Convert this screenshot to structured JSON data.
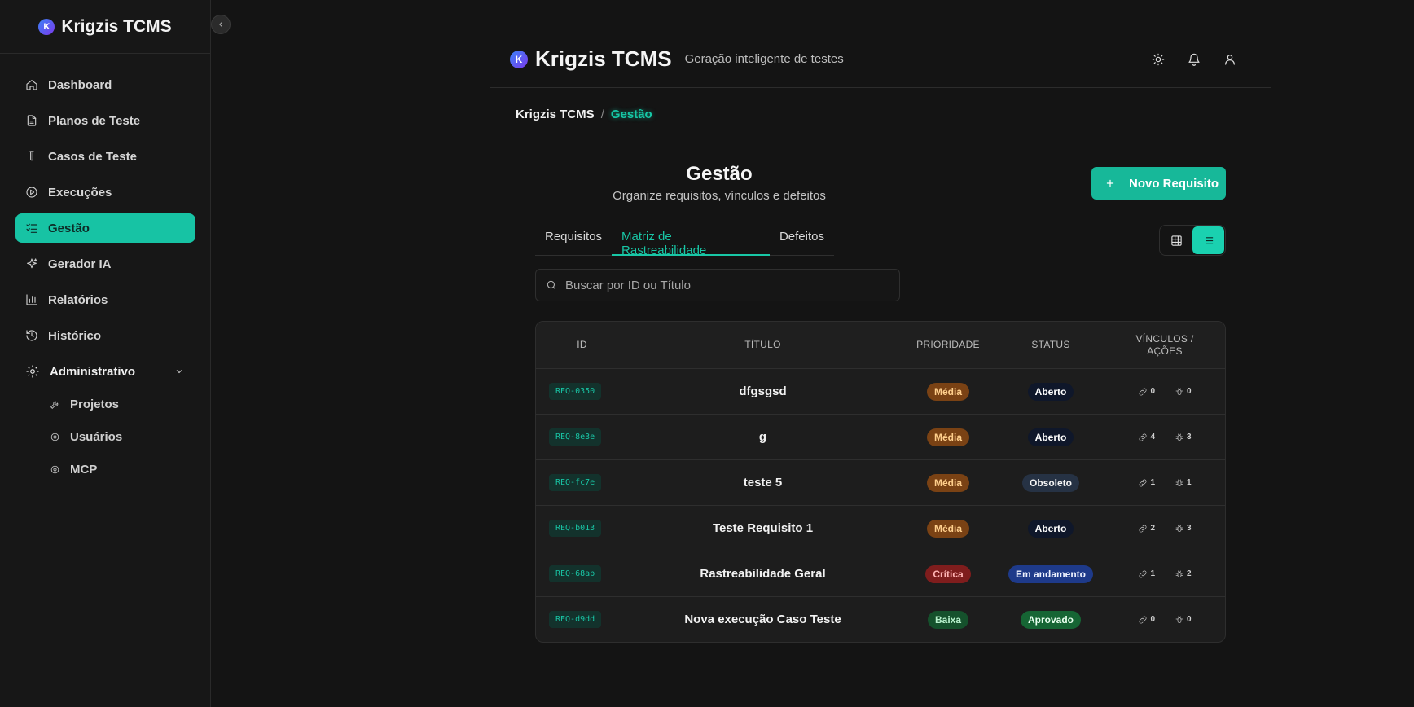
{
  "sidebar": {
    "brand": "Krigzis TCMS",
    "logo_letter": "K",
    "items": [
      {
        "label": "Dashboard",
        "icon": "home-icon"
      },
      {
        "label": "Planos de Teste",
        "icon": "document-icon"
      },
      {
        "label": "Casos de Teste",
        "icon": "test-tube-icon"
      },
      {
        "label": "Execuções",
        "icon": "play-icon"
      },
      {
        "label": "Gestão",
        "icon": "checklist-icon",
        "active": true
      },
      {
        "label": "Gerador IA",
        "icon": "sparkles-icon"
      },
      {
        "label": "Relatórios",
        "icon": "bar-chart-icon"
      },
      {
        "label": "Histórico",
        "icon": "history-icon"
      }
    ],
    "admin_group": {
      "label": "Administrativo",
      "children": [
        {
          "label": "Projetos",
          "icon": "wrench-icon"
        },
        {
          "label": "Usuários",
          "icon": "gear-icon"
        },
        {
          "label": "MCP",
          "icon": "gear-icon"
        }
      ]
    }
  },
  "header": {
    "title": "Krigzis TCMS",
    "tagline": "Geração inteligente de testes",
    "icons": [
      "sun-icon",
      "bell-icon",
      "user-icon"
    ]
  },
  "breadcrumb": {
    "root": "Krigzis TCMS",
    "separator": "/",
    "current": "Gestão"
  },
  "page": {
    "title": "Gestão",
    "subtitle": "Organize requisitos, vínculos e defeitos",
    "new_button": "Novo Requisito"
  },
  "tabs": [
    {
      "label": "Requisitos"
    },
    {
      "label": "Matriz de Rastreabilidade",
      "active": true
    },
    {
      "label": "Defeitos"
    }
  ],
  "view_toggle": {
    "options": [
      "grid-icon",
      "list-icon"
    ],
    "selected": "list-icon"
  },
  "search": {
    "placeholder": "Buscar por ID ou Título",
    "value": ""
  },
  "table": {
    "headers": {
      "id": "ID",
      "title": "TÍTULO",
      "priority": "PRIORIDADE",
      "status": "STATUS",
      "links_l1": "VÍNCULOS /",
      "links_l2": "AÇÕES"
    },
    "rows": [
      {
        "id": "REQ-0350",
        "title": "dfgsgsd",
        "priority": "Média",
        "status": "Aberto",
        "links": "0",
        "defects": "0"
      },
      {
        "id": "REQ-8e3e",
        "title": "g",
        "priority": "Média",
        "status": "Aberto",
        "links": "4",
        "defects": "3"
      },
      {
        "id": "REQ-fc7e",
        "title": "teste 5",
        "priority": "Média",
        "status": "Obsoleto",
        "links": "1",
        "defects": "1"
      },
      {
        "id": "REQ-b013",
        "title": "Teste Requisito 1",
        "priority": "Média",
        "status": "Aberto",
        "links": "2",
        "defects": "3"
      },
      {
        "id": "REQ-68ab",
        "title": "Rastreabilidade Geral",
        "priority": "Crítica",
        "status": "Em andamento",
        "links": "1",
        "defects": "2"
      },
      {
        "id": "REQ-d9dd",
        "title": "Nova execução Caso Teste",
        "priority": "Baixa",
        "status": "Aprovado",
        "links": "0",
        "defects": "0"
      }
    ]
  },
  "colors": {
    "accent": "#17c3a4",
    "background": "#141414",
    "sidebar": "#171717"
  }
}
